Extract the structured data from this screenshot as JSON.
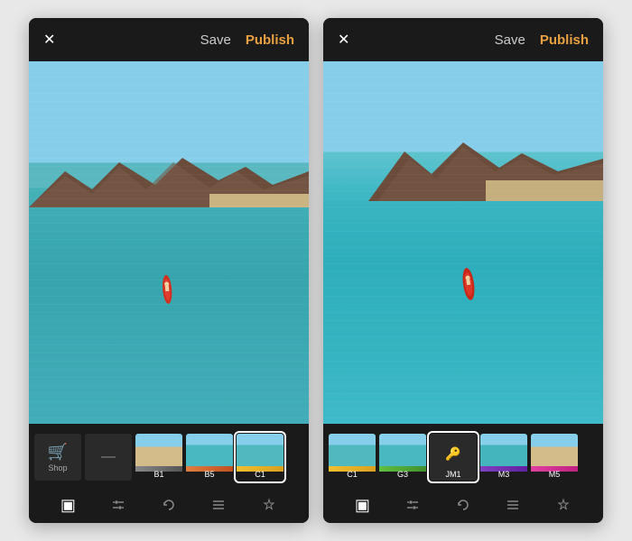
{
  "panels": [
    {
      "id": "left",
      "header": {
        "close_label": "✕",
        "save_label": "Save",
        "publish_label": "Publish"
      },
      "filters": {
        "items": [
          {
            "id": "shop",
            "label": "Shop",
            "type": "shop"
          },
          {
            "id": "none",
            "label": "—",
            "type": "thumb",
            "color": "none",
            "selected": false
          },
          {
            "id": "B1",
            "label": "B1",
            "type": "thumb",
            "color": "b1",
            "selected": false
          },
          {
            "id": "B5",
            "label": "B5",
            "type": "thumb",
            "color": "b5",
            "selected": false
          },
          {
            "id": "C1",
            "label": "C1",
            "type": "thumb",
            "color": "c1",
            "selected": true
          }
        ]
      },
      "toolbar": {
        "icons": [
          "▣",
          "⊟",
          "↺",
          "≡",
          "✦"
        ]
      }
    },
    {
      "id": "right",
      "header": {
        "close_label": "✕",
        "save_label": "Save",
        "publish_label": "Publish"
      },
      "filters": {
        "items": [
          {
            "id": "C1",
            "label": "C1",
            "type": "thumb",
            "color": "c1",
            "selected": false
          },
          {
            "id": "G3",
            "label": "G3",
            "type": "thumb",
            "color": "g3",
            "selected": false
          },
          {
            "id": "JM1",
            "label": "JM1",
            "type": "thumb-key",
            "color": "jm1",
            "selected": true
          },
          {
            "id": "M3",
            "label": "M3",
            "type": "thumb",
            "color": "m3",
            "selected": false
          },
          {
            "id": "M5",
            "label": "M5",
            "type": "thumb",
            "color": "m5",
            "selected": false
          }
        ]
      },
      "toolbar": {
        "icons": [
          "▣",
          "⊟",
          "↺",
          "≡",
          "✦"
        ]
      }
    }
  ],
  "colors": {
    "accent": "#e8a040",
    "bg": "#1a1a1a",
    "text_primary": "#ffffff",
    "text_secondary": "#cccccc"
  }
}
